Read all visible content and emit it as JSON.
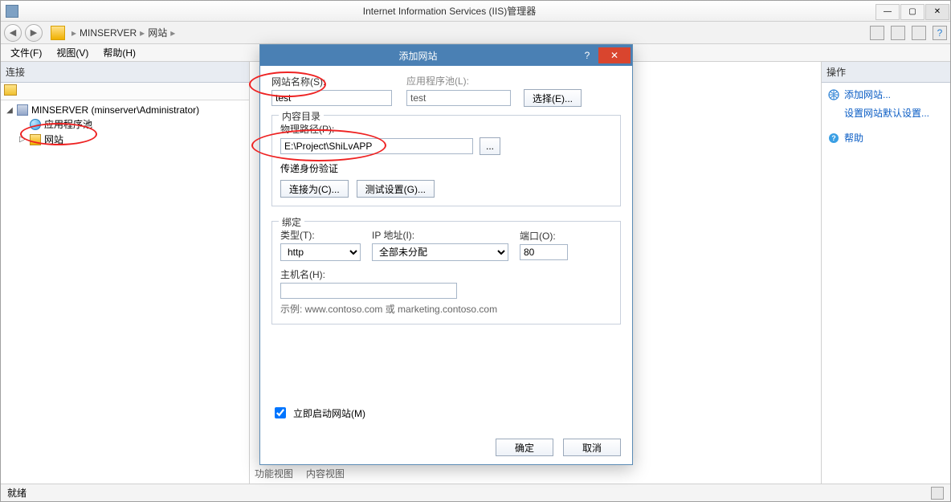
{
  "window": {
    "title": "Internet Information Services (IIS)管理器",
    "minimize_glyph": "—",
    "maximize_glyph": "▢",
    "close_glyph": "✕"
  },
  "nav": {
    "back_glyph": "◀",
    "forward_glyph": "▶",
    "breadcrumb_sep": "▸",
    "server": "MINSERVER",
    "sites": "网站"
  },
  "menu": {
    "file": "文件(F)",
    "view": "视图(V)",
    "help": "帮助(H)"
  },
  "left": {
    "header": "连接",
    "server_label": "MINSERVER (minserver\\Administrator)",
    "apppools": "应用程序池",
    "sites": "网站",
    "expander_open": "◢",
    "expander_closed": "▷"
  },
  "center": {
    "tab_features": "功能视图",
    "tab_content": "内容视图"
  },
  "right": {
    "header": "操作",
    "add_site": "添加网站...",
    "set_defaults": "设置网站默认设置...",
    "help": "帮助"
  },
  "status": {
    "ready": "就绪"
  },
  "dialog": {
    "title": "添加网站",
    "help_glyph": "?",
    "close_glyph": "✕",
    "site_name_label": "网站名称(S):",
    "app_pool_label": "应用程序池(L):",
    "site_name_value": "test",
    "app_pool_value": "test",
    "select_button": "选择(E)...",
    "content_group": "内容目录",
    "physical_path_label": "物理路径(P):",
    "physical_path_value": "E:\\Project\\ShiLvAPP",
    "browse_button": "...",
    "passthrough_label": "传递身份验证",
    "connect_as_button": "连接为(C)...",
    "test_settings_button": "测试设置(G)...",
    "binding_group": "绑定",
    "type_label": "类型(T):",
    "type_value": "http",
    "ip_label": "IP 地址(I):",
    "ip_value": "全部未分配",
    "port_label": "端口(O):",
    "port_value": "80",
    "host_label": "主机名(H):",
    "host_value": "",
    "example": "示例: www.contoso.com 或 marketing.contoso.com",
    "start_immediately": "立即启动网站(M)",
    "ok": "确定",
    "cancel": "取消"
  }
}
